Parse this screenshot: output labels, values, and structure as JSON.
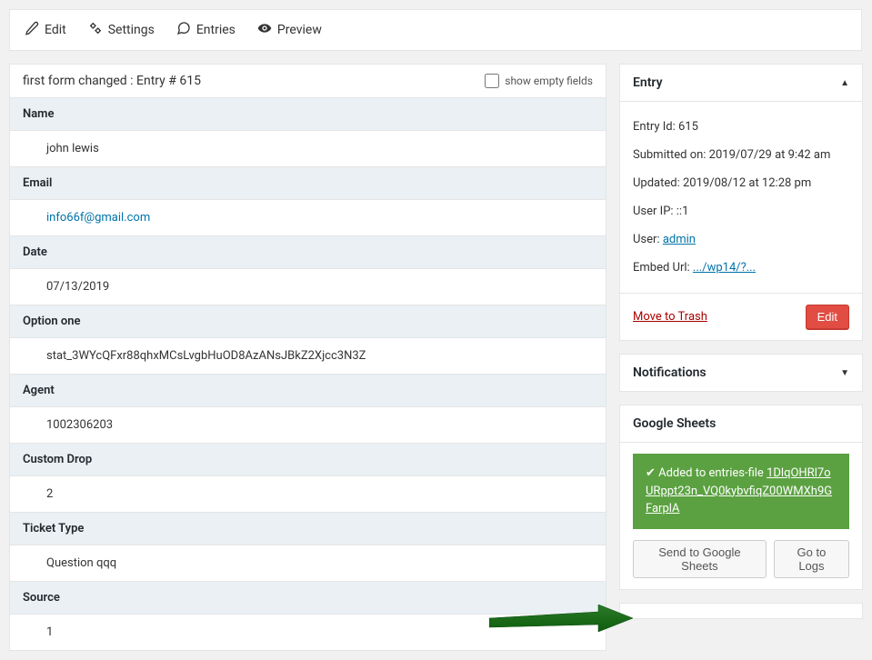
{
  "toolbar": {
    "edit_label": "Edit",
    "settings_label": "Settings",
    "entries_label": "Entries",
    "preview_label": "Preview"
  },
  "entry": {
    "title": "first form changed : Entry # 615",
    "show_empty_label": "show empty fields",
    "fields": [
      {
        "label": "Name",
        "value": "john lewis",
        "is_link": false
      },
      {
        "label": "Email",
        "value": "info66f@gmail.com",
        "is_link": true
      },
      {
        "label": "Date",
        "value": "07/13/2019",
        "is_link": false
      },
      {
        "label": "Option one",
        "value": "stat_3WYcQFxr88qhxMCsLvgbHuOD8AzANsJBkZ2Xjcc3N3Z",
        "is_link": false
      },
      {
        "label": "Agent",
        "value": "1002306203",
        "is_link": false
      },
      {
        "label": "Custom Drop",
        "value": "2",
        "is_link": false
      },
      {
        "label": "Ticket Type",
        "value": "Question qqq",
        "is_link": false
      },
      {
        "label": "Source",
        "value": "1",
        "is_link": false
      }
    ]
  },
  "sidebar_entry": {
    "title": "Entry",
    "entry_id_label": "Entry Id: ",
    "entry_id_value": "615",
    "submitted_label": "Submitted on: ",
    "submitted_value": "2019/07/29 at 9:42 am",
    "updated_label": "Updated: ",
    "updated_value": "2019/08/12 at 12:28 pm",
    "userip_label": "User IP: ",
    "userip_value": "::1",
    "user_label": "User: ",
    "user_value": "admin",
    "embed_label": "Embed Url: ",
    "embed_value": ".../wp14/?...",
    "trash_label": "Move to Trash",
    "edit_label": "Edit"
  },
  "notifications": {
    "title": "Notifications"
  },
  "google_sheets": {
    "title": "Google Sheets",
    "success_prefix": "Added to entries-file",
    "success_id": "1DlqOHRl7oURppt23n_VQ0kybvfiqZ00WMXh9GFarplA",
    "send_label": "Send to Google Sheets",
    "logs_label": "Go to Logs"
  }
}
